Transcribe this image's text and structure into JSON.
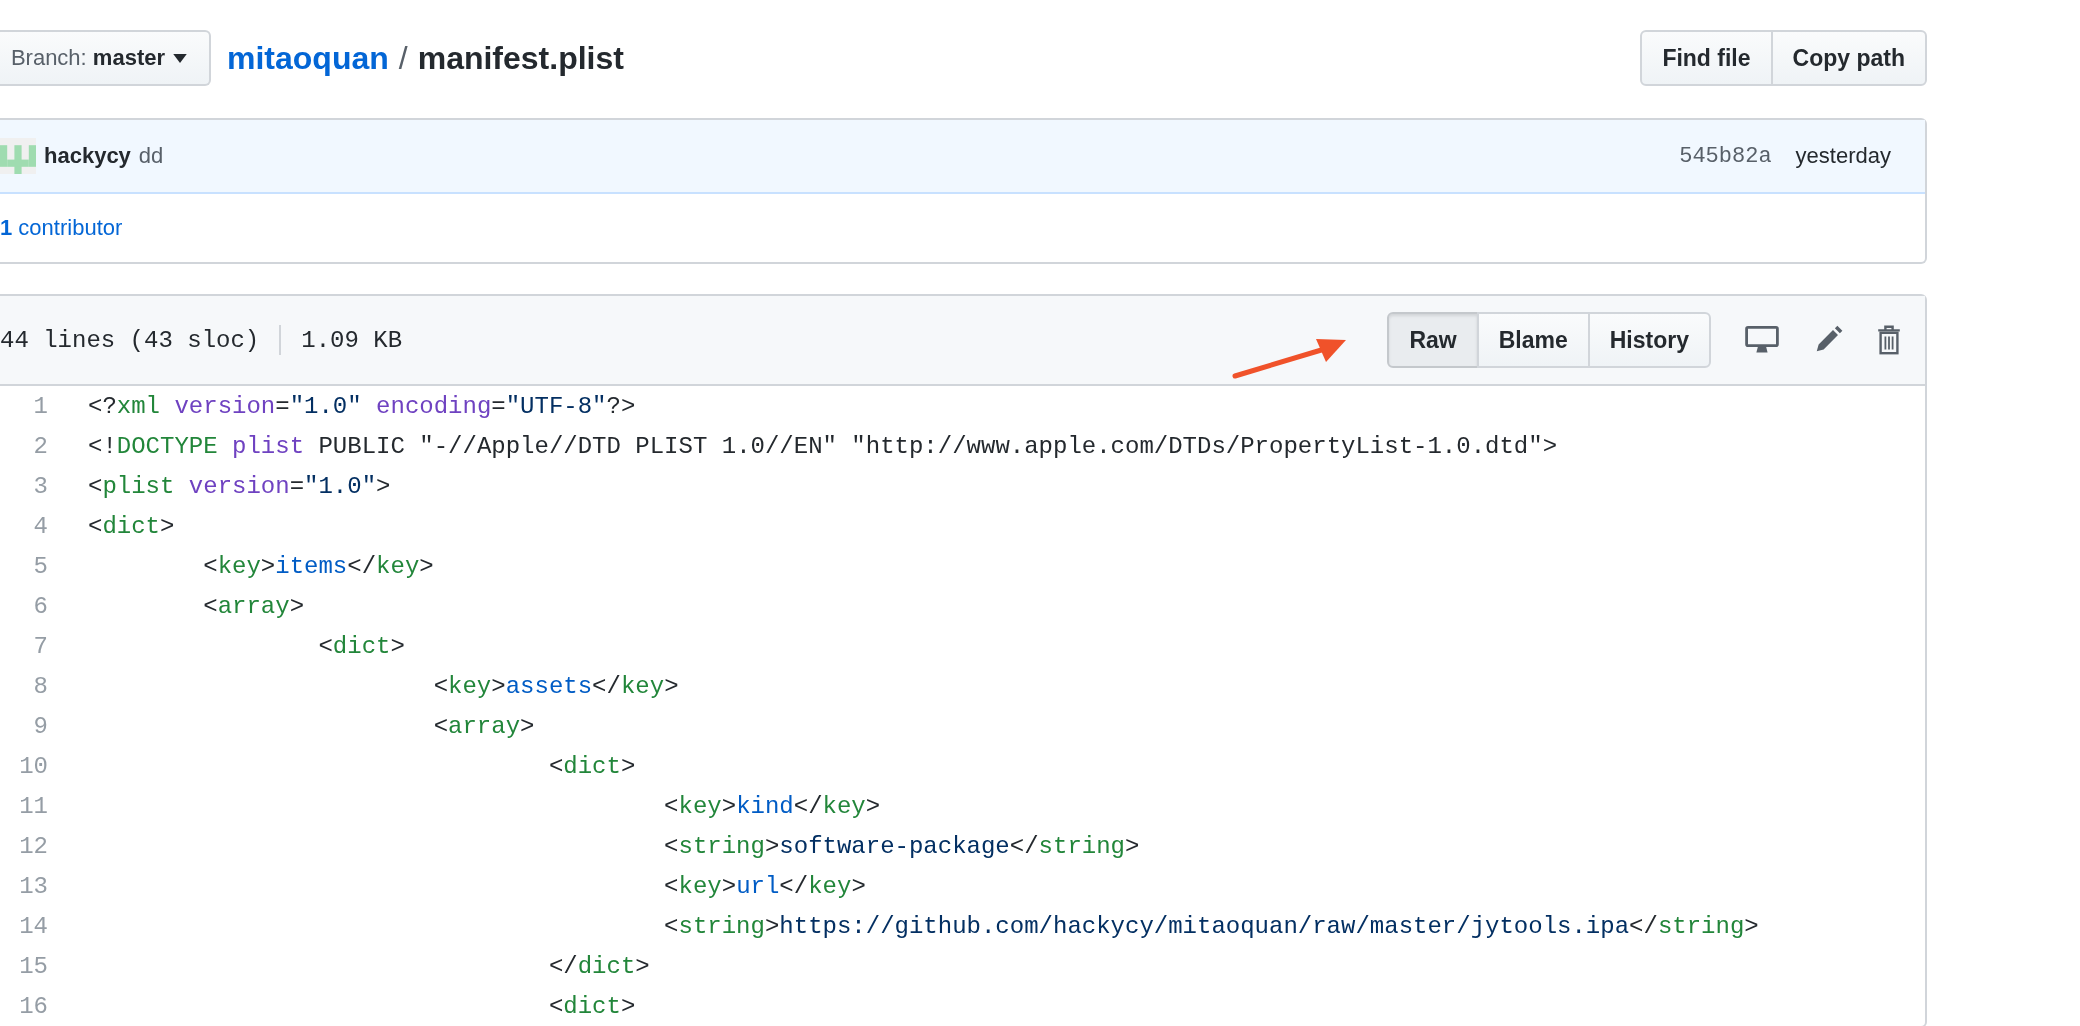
{
  "branch": {
    "label": "Branch:",
    "name": "master"
  },
  "breadcrumb": {
    "repo": "mitaoquan",
    "separator": "/",
    "file": "manifest.plist"
  },
  "file_actions": [
    "Find file",
    "Copy path"
  ],
  "commit": {
    "author": "hackycy",
    "message": "dd",
    "sha": "545b82a",
    "time": "yesterday"
  },
  "contributors": {
    "count": "1",
    "label": "contributor"
  },
  "file_info": {
    "lines": "44 lines (43 sloc)",
    "size": "1.09 KB"
  },
  "view_buttons": [
    {
      "label": "Raw",
      "selected": true
    },
    {
      "label": "Blame",
      "selected": false
    },
    {
      "label": "History",
      "selected": false
    }
  ],
  "code_lines": [
    {
      "number": "1",
      "tokens": [
        {
          "kind": "punct",
          "text": "<?"
        },
        {
          "kind": "tag",
          "text": "xml"
        },
        {
          "kind": "attr",
          "text": " version"
        },
        {
          "kind": "punct",
          "text": "="
        },
        {
          "kind": "string",
          "text": "\"1.0\""
        },
        {
          "kind": "attr",
          "text": " encoding"
        },
        {
          "kind": "punct",
          "text": "="
        },
        {
          "kind": "string",
          "text": "\"UTF-8\""
        },
        {
          "kind": "punct",
          "text": "?>"
        }
      ]
    },
    {
      "number": "2",
      "tokens": [
        {
          "kind": "punct",
          "text": "<!"
        },
        {
          "kind": "tag",
          "text": "DOCTYPE"
        },
        {
          "kind": "attr",
          "text": " plist"
        },
        {
          "kind": "punct",
          "text": " PUBLIC \"-//Apple//DTD PLIST 1.0//EN\" \"http://www.apple.com/DTDs/PropertyList-1.0.dtd\">"
        }
      ]
    },
    {
      "number": "3",
      "tokens": [
        {
          "kind": "punct",
          "text": "<"
        },
        {
          "kind": "tag",
          "text": "plist"
        },
        {
          "kind": "attr",
          "text": " version"
        },
        {
          "kind": "punct",
          "text": "="
        },
        {
          "kind": "string",
          "text": "\"1.0\""
        },
        {
          "kind": "punct",
          "text": ">"
        }
      ]
    },
    {
      "number": "4",
      "tokens": [
        {
          "kind": "punct",
          "text": "<"
        },
        {
          "kind": "tag",
          "text": "dict"
        },
        {
          "kind": "punct",
          "text": ">"
        }
      ]
    },
    {
      "number": "5",
      "tokens": [
        {
          "kind": "punct",
          "text": "\t<"
        },
        {
          "kind": "tag",
          "text": "key"
        },
        {
          "kind": "punct",
          "text": ">"
        },
        {
          "kind": "value",
          "text": "items"
        },
        {
          "kind": "punct",
          "text": "</"
        },
        {
          "kind": "tag",
          "text": "key"
        },
        {
          "kind": "punct",
          "text": ">"
        }
      ]
    },
    {
      "number": "6",
      "tokens": [
        {
          "kind": "punct",
          "text": "\t<"
        },
        {
          "kind": "tag",
          "text": "array"
        },
        {
          "kind": "punct",
          "text": ">"
        }
      ]
    },
    {
      "number": "7",
      "tokens": [
        {
          "kind": "punct",
          "text": "\t\t<"
        },
        {
          "kind": "tag",
          "text": "dict"
        },
        {
          "kind": "punct",
          "text": ">"
        }
      ]
    },
    {
      "number": "8",
      "tokens": [
        {
          "kind": "punct",
          "text": "\t\t\t<"
        },
        {
          "kind": "tag",
          "text": "key"
        },
        {
          "kind": "punct",
          "text": ">"
        },
        {
          "kind": "value",
          "text": "assets"
        },
        {
          "kind": "punct",
          "text": "</"
        },
        {
          "kind": "tag",
          "text": "key"
        },
        {
          "kind": "punct",
          "text": ">"
        }
      ]
    },
    {
      "number": "9",
      "tokens": [
        {
          "kind": "punct",
          "text": "\t\t\t<"
        },
        {
          "kind": "tag",
          "text": "array"
        },
        {
          "kind": "punct",
          "text": ">"
        }
      ]
    },
    {
      "number": "10",
      "tokens": [
        {
          "kind": "punct",
          "text": "\t\t\t\t<"
        },
        {
          "kind": "tag",
          "text": "dict"
        },
        {
          "kind": "punct",
          "text": ">"
        }
      ]
    },
    {
      "number": "11",
      "tokens": [
        {
          "kind": "punct",
          "text": "\t\t\t\t\t<"
        },
        {
          "kind": "tag",
          "text": "key"
        },
        {
          "kind": "punct",
          "text": ">"
        },
        {
          "kind": "value",
          "text": "kind"
        },
        {
          "kind": "punct",
          "text": "</"
        },
        {
          "kind": "tag",
          "text": "key"
        },
        {
          "kind": "punct",
          "text": ">"
        }
      ]
    },
    {
      "number": "12",
      "tokens": [
        {
          "kind": "punct",
          "text": "\t\t\t\t\t<"
        },
        {
          "kind": "tag",
          "text": "string"
        },
        {
          "kind": "punct",
          "text": ">"
        },
        {
          "kind": "string",
          "text": "software-package"
        },
        {
          "kind": "punct",
          "text": "</"
        },
        {
          "kind": "tag",
          "text": "string"
        },
        {
          "kind": "punct",
          "text": ">"
        }
      ]
    },
    {
      "number": "13",
      "tokens": [
        {
          "kind": "punct",
          "text": "\t\t\t\t\t<"
        },
        {
          "kind": "tag",
          "text": "key"
        },
        {
          "kind": "punct",
          "text": ">"
        },
        {
          "kind": "value",
          "text": "url"
        },
        {
          "kind": "punct",
          "text": "</"
        },
        {
          "kind": "tag",
          "text": "key"
        },
        {
          "kind": "punct",
          "text": ">"
        }
      ]
    },
    {
      "number": "14",
      "tokens": [
        {
          "kind": "punct",
          "text": "\t\t\t\t\t<"
        },
        {
          "kind": "tag",
          "text": "string"
        },
        {
          "kind": "punct",
          "text": ">"
        },
        {
          "kind": "string",
          "text": "https://github.com/hackycy/mitaoquan/raw/master/jytools.ipa"
        },
        {
          "kind": "punct",
          "text": "</"
        },
        {
          "kind": "tag",
          "text": "string"
        },
        {
          "kind": "punct",
          "text": ">"
        }
      ]
    },
    {
      "number": "15",
      "tokens": [
        {
          "kind": "punct",
          "text": "\t\t\t\t</"
        },
        {
          "kind": "tag",
          "text": "dict"
        },
        {
          "kind": "punct",
          "text": ">"
        }
      ]
    },
    {
      "number": "16",
      "tokens": [
        {
          "kind": "punct",
          "text": "\t\t\t\t<"
        },
        {
          "kind": "tag",
          "text": "dict"
        },
        {
          "kind": "punct",
          "text": ">"
        }
      ]
    }
  ]
}
